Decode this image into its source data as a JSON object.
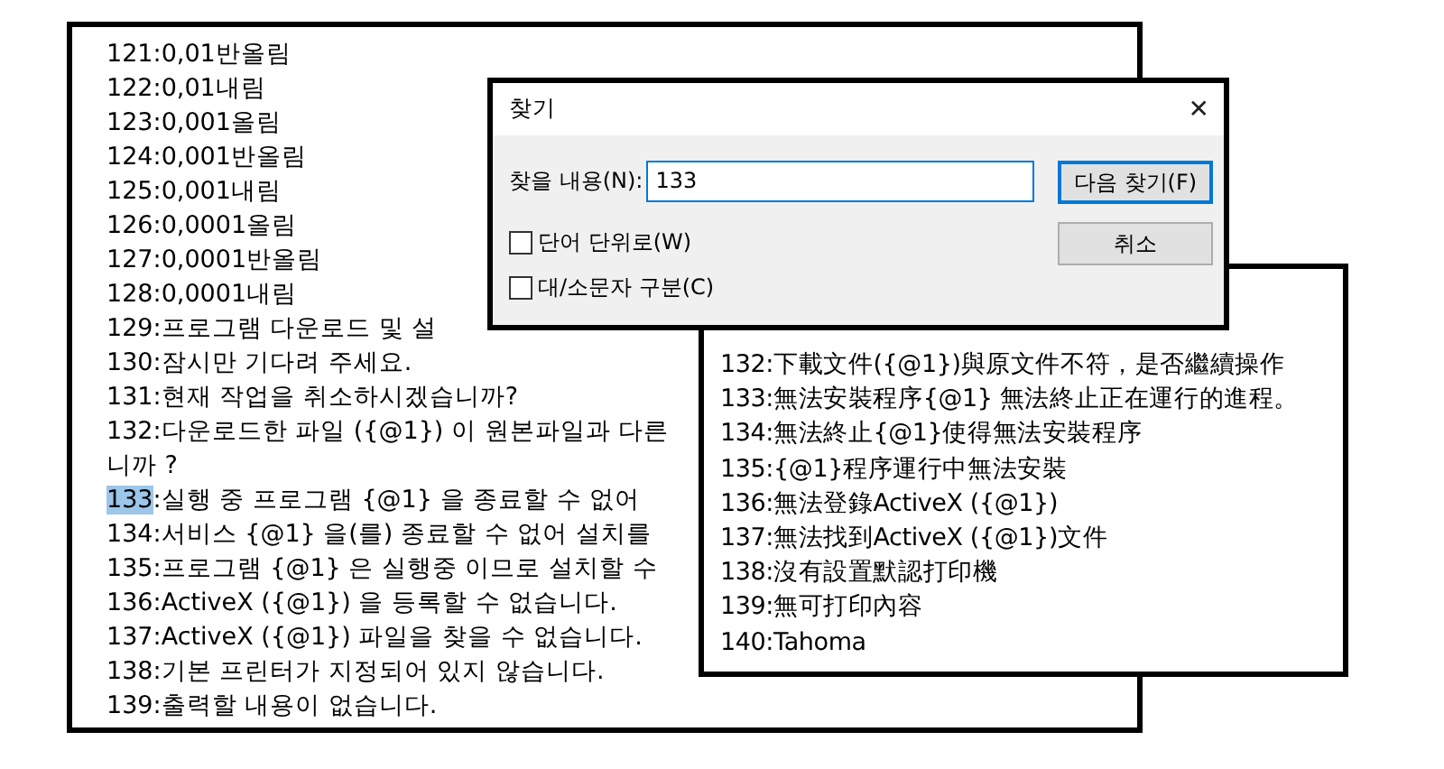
{
  "back_panel": {
    "lines": [
      {
        "kind": "plain",
        "text": "121:0,01반올림"
      },
      {
        "kind": "plain",
        "text": "122:0,01내림"
      },
      {
        "kind": "plain",
        "text": "123:0,001올림"
      },
      {
        "kind": "plain",
        "text": "124:0,001반올림"
      },
      {
        "kind": "plain",
        "text": "125:0,001내림"
      },
      {
        "kind": "plain",
        "text": "126:0,0001올림"
      },
      {
        "kind": "plain",
        "text": "127:0,0001반올림"
      },
      {
        "kind": "plain",
        "text": "128:0,0001내림"
      },
      {
        "kind": "plain",
        "text": "129:프로그램 다운로드 및 설"
      },
      {
        "kind": "plain",
        "text": "130:잠시만 기다려 주세요."
      },
      {
        "kind": "plain",
        "text": "131:현재 작업을 취소하시겠습니까?"
      },
      {
        "kind": "plain",
        "text": "132:다운로드한 파일 ({@1}) 이 원본파일과 다른"
      },
      {
        "kind": "plain",
        "text": "니까 ?"
      },
      {
        "kind": "match",
        "match": "133",
        "text": ":실행 중 프로그램 {@1} 을 종료할 수 없어"
      },
      {
        "kind": "plain",
        "text": "134:서비스 {@1} 을(를) 종료할 수 없어 설치를"
      },
      {
        "kind": "plain",
        "text": "135:프로그램 {@1} 은 실행중 이므로 설치할 수"
      },
      {
        "kind": "plain",
        "text": "136:ActiveX ({@1}) 을 등록할 수 없습니다."
      },
      {
        "kind": "plain",
        "text": "137:ActiveX ({@1}) 파일을 찾을 수 없습니다."
      },
      {
        "kind": "plain",
        "text": "138:기본 프린터가 지정되어 있지 않습니다."
      },
      {
        "kind": "plain",
        "text": "139:출력할 내용이 없습니다."
      }
    ]
  },
  "front_panel": {
    "lines": [
      "132:下載文件({@1})與原文件不符，是否繼續操作",
      "133:無法安裝程序{@1} 無法終止正在運行的進程。",
      "134:無法終止{@1}使得無法安裝程序",
      "135:{@1}程序運行中無法安裝",
      "136:無法登錄ActiveX ({@1})",
      "137:無法找到ActiveX ({@1})文件",
      "138:沒有設置默認打印機",
      "139:無可打印內容",
      "140:Tahoma"
    ]
  },
  "dialog": {
    "title": "찾기",
    "close": "✕",
    "find_label": "찾을 내용(N):",
    "find_value": "133",
    "checkboxes": [
      {
        "label": "단어 단위로(W)",
        "checked": false
      },
      {
        "label": "대/소문자 구분(C)",
        "checked": false
      }
    ],
    "buttons": [
      {
        "label": "다음 찾기(F)",
        "default": true
      },
      {
        "label": "취소",
        "default": false
      }
    ]
  }
}
